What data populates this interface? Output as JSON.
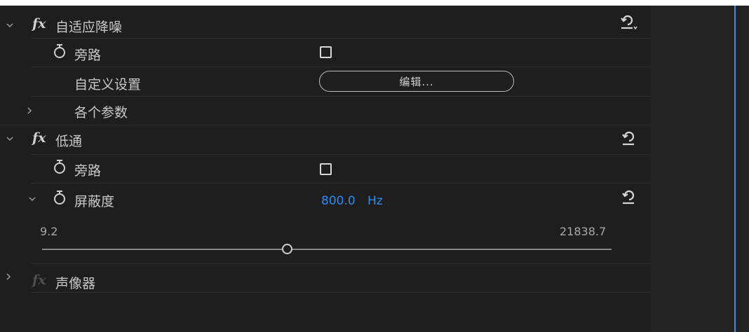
{
  "effects": [
    {
      "name": "自适应降噪",
      "fx_label": "fx",
      "expanded": true,
      "params": [
        {
          "label": "旁路",
          "control": "checkbox",
          "checked": false
        },
        {
          "label": "自定义设置",
          "control": "button",
          "button_label": "编辑..."
        },
        {
          "label": "各个参数",
          "control": "group",
          "expanded": false
        }
      ]
    },
    {
      "name": "低通",
      "fx_label": "fx",
      "expanded": true,
      "params": [
        {
          "label": "旁路",
          "control": "checkbox",
          "checked": false
        },
        {
          "label": "屏蔽度",
          "control": "slider",
          "value": "800.0",
          "unit": "Hz",
          "min": "9.2",
          "max": "21838.7",
          "expanded": true
        }
      ]
    },
    {
      "name": "声像器",
      "fx_label": "fx",
      "expanded": false,
      "enabled": false
    }
  ],
  "colors": {
    "panel_background": "#1e1e1e",
    "value_accent": "#2d8ceb",
    "playhead": "#2d8ceb"
  },
  "icons": [
    "chevron-down-icon",
    "chevron-right-icon",
    "stopwatch-icon",
    "reset-icon",
    "checkbox"
  ]
}
